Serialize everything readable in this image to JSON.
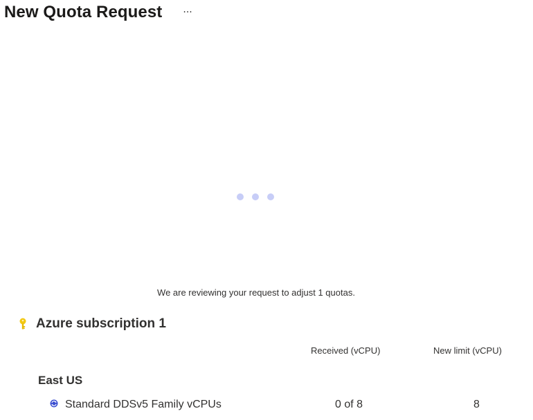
{
  "header": {
    "title": "New Quota Request",
    "more_label": "···"
  },
  "status": {
    "message": "We are reviewing your request to adjust 1 quotas."
  },
  "subscription": {
    "name": "Azure subscription 1",
    "icon": "key-icon",
    "icon_color": "#f2c811"
  },
  "columns": {
    "received": "Received (vCPU)",
    "new_limit": "New limit (vCPU)"
  },
  "region": {
    "name": "East US"
  },
  "quotas": [
    {
      "icon": "vm-quota-icon",
      "name": "Standard DDSv5 Family vCPUs",
      "received": "0 of 8",
      "new_limit": "8"
    }
  ],
  "colors": {
    "loader_dot": "#c7cdf7",
    "text": "#323130"
  }
}
